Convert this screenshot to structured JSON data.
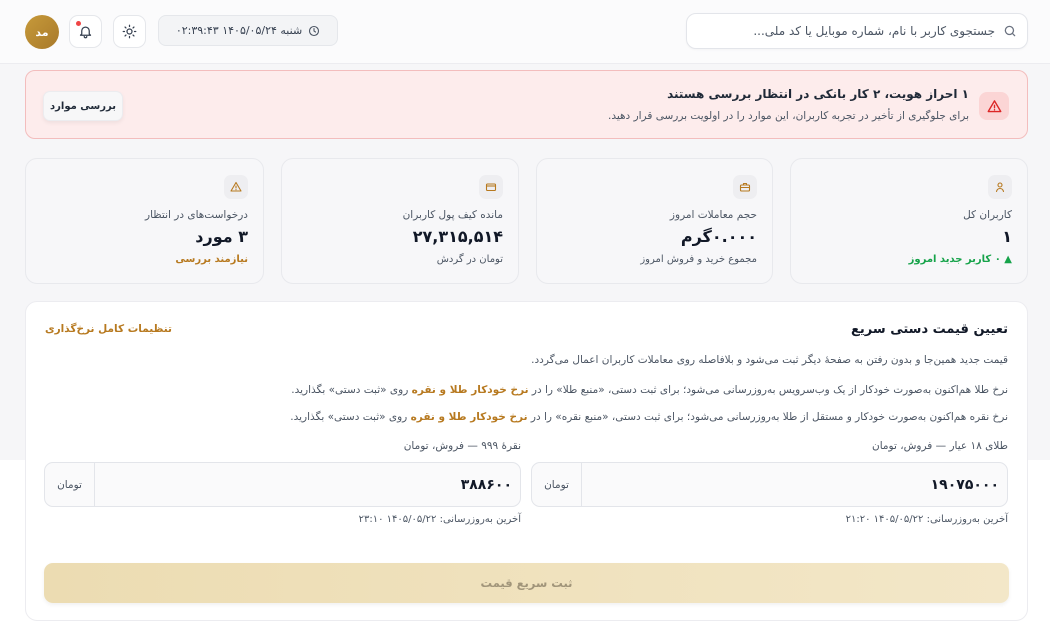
{
  "header": {
    "search_placeholder": "جستجوی کاربر با نام، شماره موبایل یا کد ملی...",
    "datetime": "شنبه ۱۴۰۵/۰۵/۲۴ ۰۲:۳۹:۴۳",
    "avatar_initials": "مد"
  },
  "alert": {
    "title": "۱ احراز هویت، ۲ کار بانکی در انتظار بررسی هستند",
    "description": "برای جلوگیری از تأخیر در تجربه کاربران، این موارد را در اولویت بررسی قرار دهید.",
    "button": "بررسی موارد"
  },
  "stats": [
    {
      "label": "کاربران کل",
      "value": "۱",
      "sub": "▲ ۰ کاربر جدید امروز",
      "icon": "user-icon"
    },
    {
      "label": "حجم معاملات امروز",
      "value": "۰.۰۰۰گرم",
      "sub": "مجموع خرید و فروش امروز",
      "icon": "briefcase-icon"
    },
    {
      "label": "مانده کیف پول کاربران",
      "value": "۲۷,۳۱۵,۵۱۴",
      "sub": "تومان در گردش",
      "icon": "wallet-icon"
    },
    {
      "label": "درخواست‌های در انتظار",
      "value": "۳ مورد",
      "sub": "نیازمند بررسی",
      "icon": "warning-icon"
    }
  ],
  "price_panel": {
    "title": "تعیین قیمت دستی سریع",
    "settings_link": "تنظیمات کامل نرخ‌گذاری",
    "intro": "قیمت جدید همین‌جا و بدون رفتن به صفحهٔ دیگر ثبت می‌شود و بلافاصله روی معاملات کاربران اعمال می‌گردد.",
    "gold_note": {
      "part1": "نرخ طلا هم‌اکنون به‌صورت خودکار از یک وب‌سرویس به‌روزرسانی می‌شود؛ برای ثبت دستی، «منبع طلا» را در ",
      "highlight": "نرخ خودکار طلا و نقره",
      "part2": " روی «ثبت دستی» بگذارید."
    },
    "silver_note": {
      "part1": "نرخ نقره هم‌اکنون به‌صورت خودکار و مستقل از طلا به‌روزرسانی می‌شود؛ برای ثبت دستی، «منبع نقره» را در ",
      "highlight": "نرخ خودکار طلا و نقره",
      "part2": " روی «ثبت دستی» بگذارید."
    },
    "gold": {
      "label": "طلای ۱۸ عیار — فروش، تومان",
      "value": "۱۹۰۷۵۰۰۰",
      "unit": "تومان",
      "updated": "آخرین به‌روزرسانی: ۱۴۰۵/۰۵/۲۲ ۲۱:۲۰"
    },
    "silver": {
      "label": "نقرهٔ ۹۹۹ — فروش، تومان",
      "value": "۳۸۸۶۰۰",
      "unit": "تومان",
      "updated": "آخرین به‌روزرسانی: ۱۴۰۵/۰۵/۲۲ ۲۳:۱۰"
    },
    "submit": "ثبت سریع قیمت"
  }
}
